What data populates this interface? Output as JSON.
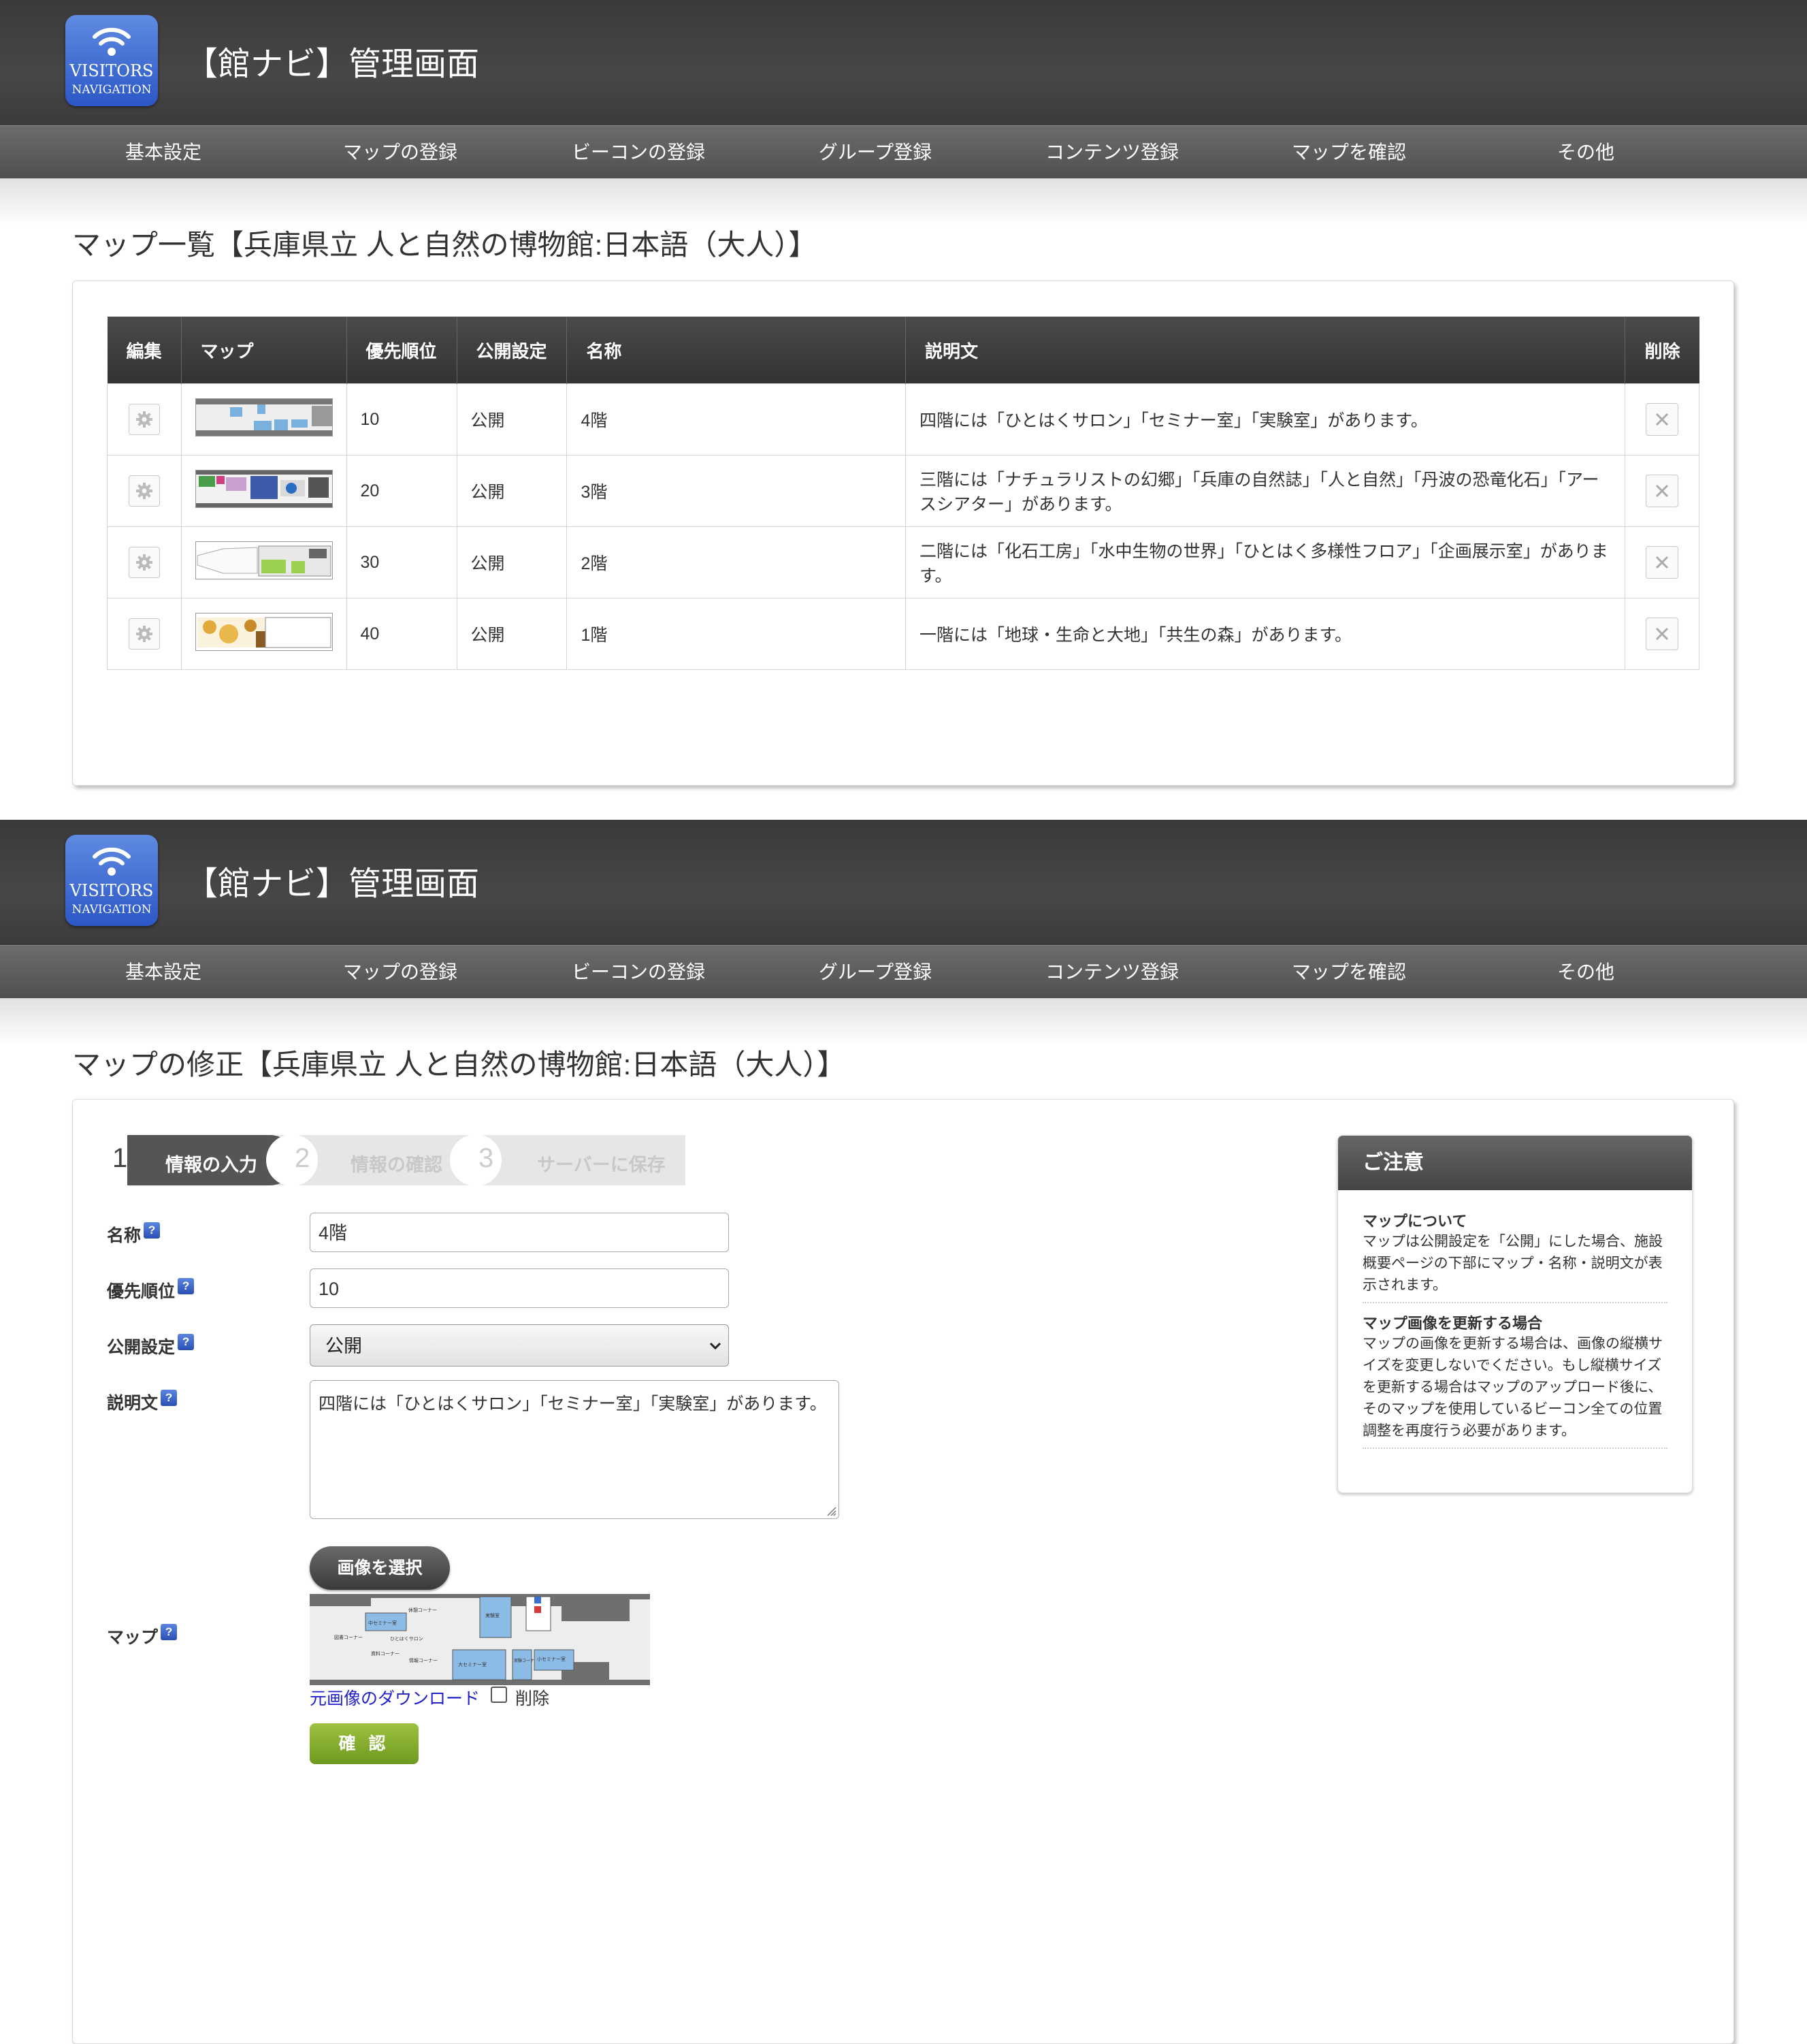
{
  "app": {
    "logo_line1": "VISITORS",
    "logo_line2": "NAVIGATION",
    "title": "【館ナビ】管理画面"
  },
  "nav": [
    "基本設定",
    "マップの登録",
    "ビーコンの登録",
    "グループ登録",
    "コンテンツ登録",
    "マップを確認",
    "その他"
  ],
  "list_page": {
    "title": "マップ一覧【兵庫県立 人と自然の博物館:日本語（大人）】",
    "columns": [
      "編集",
      "マップ",
      "優先順位",
      "公開設定",
      "名称",
      "説明文",
      "削除"
    ],
    "rows": [
      {
        "priority": "10",
        "status": "公開",
        "name": "4階",
        "desc": "四階には「ひとはくサロン」「セミナー室」「実験室」があります。"
      },
      {
        "priority": "20",
        "status": "公開",
        "name": "3階",
        "desc": "三階には「ナチュラリストの幻郷」「兵庫の自然誌」「人と自然」「丹波の恐竜化石」「アースシアター」があります。"
      },
      {
        "priority": "30",
        "status": "公開",
        "name": "2階",
        "desc": "二階には「化石工房」「水中生物の世界」「ひとはく多様性フロア」「企画展示室」があります。"
      },
      {
        "priority": "40",
        "status": "公開",
        "name": "1階",
        "desc": "一階には「地球・生命と大地」「共生の森」があります。"
      }
    ]
  },
  "edit_page": {
    "title": "マップの修正【兵庫県立 人と自然の博物館:日本語（大人）】",
    "steps": [
      {
        "num": "1",
        "label": "情報の入力"
      },
      {
        "num": "2",
        "label": "情報の確認"
      },
      {
        "num": "3",
        "label": "サーバーに保存"
      }
    ],
    "fields": {
      "name_label": "名称",
      "name_value": "4階",
      "priority_label": "優先順位",
      "priority_value": "10",
      "status_label": "公開設定",
      "status_value": "公開",
      "desc_label": "説明文",
      "desc_value": "四階には「ひとはくサロン」「セミナー室」「実験室」があります。",
      "map_label": "マップ",
      "help": "?"
    },
    "select_image_button": "画像を選択",
    "download_link": "元画像のダウンロード",
    "delete_checkbox_label": "削除",
    "confirm_button": "確 認",
    "map_preview_labels": [
      "休憩コーナー",
      "中セミナー室",
      "実験室",
      "ひとはくサロン",
      "図書コーナー",
      "資料コーナー",
      "情報コーナー",
      "大セミナー室",
      "実験コーナー室",
      "小セミナー室"
    ],
    "notice": {
      "title": "ご注意",
      "items": [
        {
          "title": "マップについて",
          "text": "マップは公開設定を「公開」にした場合、施設概要ページの下部にマップ・名称・説明文が表示されます。"
        },
        {
          "title": "マップ画像を更新する場合",
          "text": "マップの画像を更新する場合は、画像の縦横サイズを変更しないでください。もし縦横サイズを更新する場合はマップのアップロード後に、そのマップを使用しているビーコン全ての位置調整を再度行う必要があります。"
        }
      ]
    }
  }
}
